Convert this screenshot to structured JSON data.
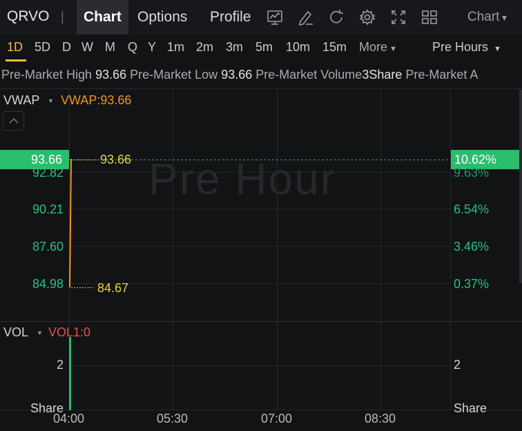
{
  "header": {
    "ticker": "QRVO",
    "separator": "|",
    "tabs": [
      "Chart",
      "Options",
      "Profile"
    ],
    "active_tab": "Chart",
    "chart_dropdown": "Chart",
    "icons": [
      "chart-type-icon",
      "draw-pen-icon",
      "refresh-icon",
      "settings-gear-icon",
      "fullscreen-icon",
      "layout-grid-icon"
    ]
  },
  "periods": {
    "items": [
      "1D",
      "5D",
      "D",
      "W",
      "M",
      "Q",
      "Y",
      "1m",
      "2m",
      "3m",
      "5m",
      "10m",
      "15m"
    ],
    "more_label": "More",
    "active": "1D",
    "session_label": "Pre Hours"
  },
  "info_bar": {
    "pre_high_label": "Pre-Market High",
    "pre_high_value": "93.66",
    "pre_low_label": "Pre-Market Low",
    "pre_low_value": "93.66",
    "pre_volume_label": "Pre-Market Volume",
    "pre_volume_value": "3Share",
    "pre_avg_label": "Pre-Market A"
  },
  "chart": {
    "watermark": "Pre Hour",
    "colors": {
      "up": "#2bbd6e",
      "vwap": "#f0952a",
      "highlow": "#e9d33f",
      "vol_label": "#e0544f",
      "grid": "#25272b"
    }
  },
  "chart_data": {
    "type": "line",
    "indicator_label": "VWAP",
    "indicator_value": "VWAP:93.66",
    "current_price": "93.66",
    "current_change_pct": "10.62%",
    "high_marker": "93.66",
    "low_marker": "84.67",
    "y_ticks_left": [
      "92.82",
      "90.21",
      "87.60",
      "84.98"
    ],
    "y_ticks_right": [
      "9.63%",
      "6.54%",
      "3.46%",
      "0.37%"
    ],
    "x_ticks": [
      "04:00",
      "05:30",
      "07:00",
      "08:30"
    ],
    "ylim": [
      84.67,
      93.66
    ],
    "series": [
      {
        "values": [
          84.67,
          93.66
        ]
      }
    ],
    "volume": {
      "label": "VOL",
      "value_label": "VOL1:0",
      "tick_left": "2",
      "tick_right": "2",
      "unit_left": "Share",
      "unit_right": "Share",
      "bars": [
        2
      ]
    }
  }
}
